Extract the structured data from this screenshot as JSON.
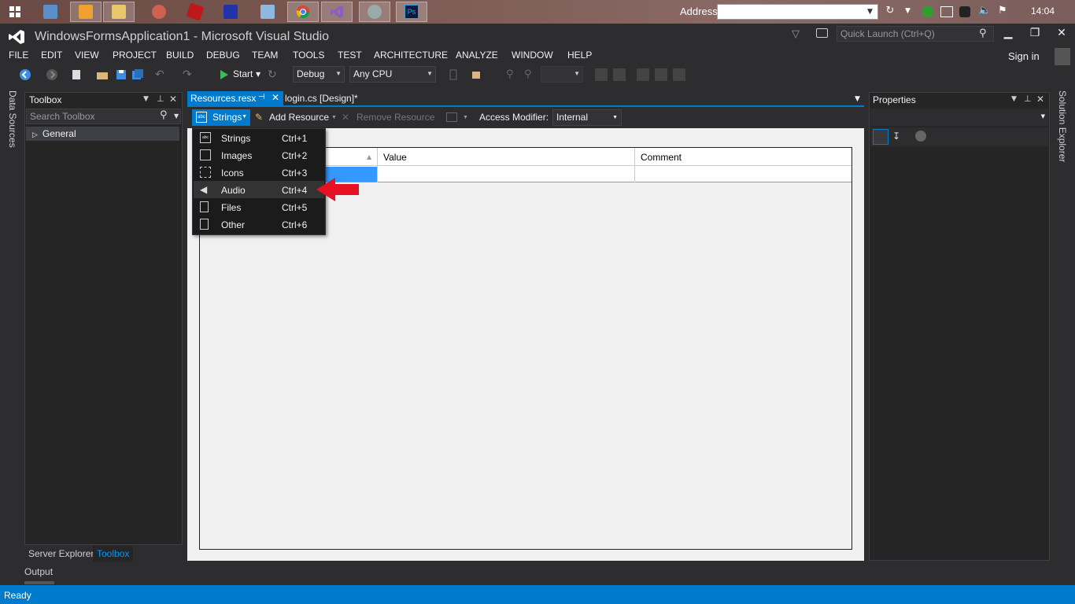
{
  "taskbar": {
    "address_label": "Address",
    "address_value": "",
    "clock": "14:04",
    "apps": [
      "windows-start",
      "remote-desktop",
      "media-player",
      "file-explorer",
      "paint",
      "app-red",
      "book-app",
      "notepad",
      "chrome",
      "visual-studio",
      "app-game",
      "photoshop"
    ],
    "photoshop_label": "Ps"
  },
  "window": {
    "title": "WindowsFormsApplication1 - Microsoft Visual Studio",
    "quick_launch_placeholder": "Quick Launch (Ctrl+Q)"
  },
  "menu": [
    "FILE",
    "EDIT",
    "VIEW",
    "PROJECT",
    "BUILD",
    "DEBUG",
    "TEAM",
    "TOOLS",
    "TEST",
    "ARCHITECTURE",
    "ANALYZE",
    "WINDOW",
    "HELP"
  ],
  "sign_in": "Sign in",
  "toolbar": {
    "start_label": "Start",
    "config": "Debug",
    "platform": "Any CPU"
  },
  "left_rail": {
    "data_sources": "Data Sources"
  },
  "right_rail": {
    "solution_explorer": "Solution Explorer"
  },
  "toolbox": {
    "title": "Toolbox",
    "search_placeholder": "Search Toolbox",
    "group": "General",
    "tabs": [
      "Server Explorer",
      "Toolbox"
    ],
    "output": "Output"
  },
  "doc_tabs": {
    "active": "Resources.resx",
    "other": "login.cs [Design]*"
  },
  "resource_toolbar": {
    "strings": "Strings",
    "add_resource": "Add Resource",
    "remove_resource": "Remove Resource",
    "access_modifier_label": "Access Modifier:",
    "access_modifier_value": "Internal"
  },
  "grid": {
    "columns": [
      "Value",
      "Comment"
    ]
  },
  "resource_menu": [
    {
      "label": "Strings",
      "shortcut": "Ctrl+1",
      "icon": "strings-icon"
    },
    {
      "label": "Images",
      "shortcut": "Ctrl+2",
      "icon": "images-icon"
    },
    {
      "label": "Icons",
      "shortcut": "Ctrl+3",
      "icon": "icons-icon"
    },
    {
      "label": "Audio",
      "shortcut": "Ctrl+4",
      "icon": "audio-icon"
    },
    {
      "label": "Files",
      "shortcut": "Ctrl+5",
      "icon": "files-icon"
    },
    {
      "label": "Other",
      "shortcut": "Ctrl+6",
      "icon": "other-icon"
    }
  ],
  "properties": {
    "title": "Properties"
  },
  "status": {
    "text": "Ready"
  },
  "colors": {
    "accent": "#007acc",
    "annotation_arrow": "#e81123"
  }
}
